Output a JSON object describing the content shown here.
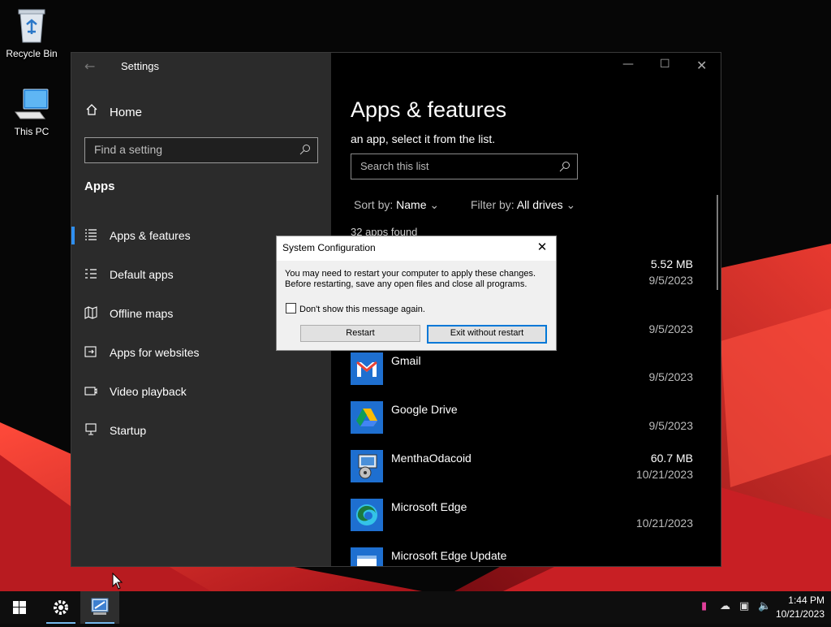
{
  "desktop": {
    "icons": [
      {
        "label": "Recycle Bin"
      },
      {
        "label": "This PC"
      }
    ]
  },
  "settings": {
    "window_title": "Settings",
    "nav": {
      "home": "Home",
      "search_placeholder": "Find a setting",
      "section": "Apps",
      "items": [
        {
          "label": "Apps & features",
          "icon": "apps-features-icon",
          "selected": true
        },
        {
          "label": "Default apps",
          "icon": "default-apps-icon"
        },
        {
          "label": "Offline maps",
          "icon": "offline-maps-icon"
        },
        {
          "label": "Apps for websites",
          "icon": "apps-websites-icon"
        },
        {
          "label": "Video playback",
          "icon": "video-playback-icon"
        },
        {
          "label": "Startup",
          "icon": "startup-icon"
        }
      ]
    },
    "content": {
      "title": "Apps & features",
      "description": "an app, select it from the list.",
      "search_placeholder": "Search this list",
      "sort_label": "Sort by:",
      "sort_value": "Name",
      "filter_label": "Filter by:",
      "filter_value": "All drives",
      "count": "32 apps found",
      "apps": [
        {
          "name": "",
          "size": "5.52 MB",
          "date": "9/5/2023"
        },
        {
          "name": "",
          "size": "",
          "date": "9/5/2023"
        },
        {
          "name": "Gmail",
          "size": "",
          "date": "9/5/2023"
        },
        {
          "name": "Google Drive",
          "size": "",
          "date": "9/5/2023"
        },
        {
          "name": "MenthaOdacoid",
          "size": "60.7 MB",
          "date": "10/21/2023"
        },
        {
          "name": "Microsoft Edge",
          "size": "",
          "date": "10/21/2023"
        },
        {
          "name": "Microsoft Edge Update",
          "size": "",
          "date": ""
        }
      ]
    }
  },
  "dialog": {
    "title": "System Configuration",
    "message_line1": "You may need to restart your computer to apply these changes.",
    "message_line2": "Before restarting, save any open files and close all programs.",
    "checkbox_label": "Don't show this message again.",
    "restart_label": "Restart",
    "exit_label": "Exit without restart"
  },
  "taskbar": {
    "time": "1:44 PM",
    "date": "10/21/2023"
  },
  "colors": {
    "accent": "#0078d7",
    "nav_selected": "#2f8ff0",
    "wallpaper_red": "#d42a2a"
  }
}
